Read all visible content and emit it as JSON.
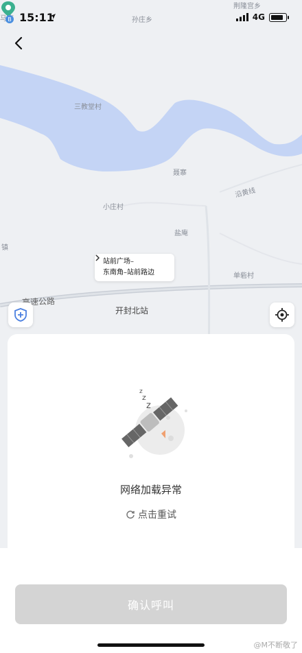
{
  "status_bar": {
    "time": "15:11",
    "network": "4G"
  },
  "map": {
    "labels": {
      "maz": "马庄",
      "sunzhuang": "孙庄乡",
      "xingang": "荆隆宫乡",
      "sanjiao": "三教堂村",
      "lizhai": "聂寨",
      "yanhuang": "沿黄线",
      "xiaozhuang": "小庄村",
      "yanyan": "盐庵",
      "zhen": "镇",
      "shanzhai": "单砦村",
      "highway": "高速公路",
      "station": "开封北站"
    },
    "callout": {
      "line1": "站前广场–",
      "line2": "东南角–站前路边"
    }
  },
  "card": {
    "error_text": "网络加载异常",
    "retry_label": "点击重试"
  },
  "bottom": {
    "confirm_label": "确认呼叫",
    "watermark": "@M不断敬了"
  },
  "colors": {
    "water": "#c4d4f5",
    "button_disabled": "#d4d4d4",
    "pin": "#3bb08f",
    "marker": "#4a8fe0"
  }
}
